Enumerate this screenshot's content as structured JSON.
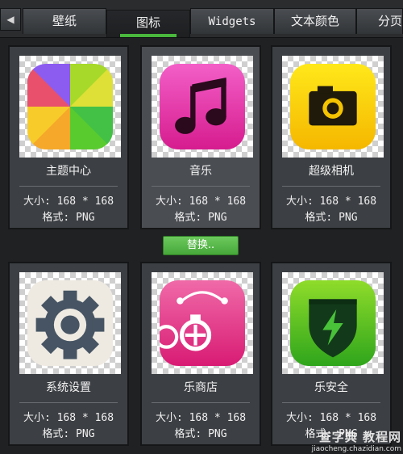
{
  "tabs": {
    "prev_arrow": "◀",
    "items": [
      {
        "label": "壁纸"
      },
      {
        "label": "图标"
      },
      {
        "label": "Widgets"
      },
      {
        "label": "文本颜色"
      },
      {
        "label": "分页"
      }
    ],
    "active_index": 1,
    "accent": "#49b83d"
  },
  "icons": [
    {
      "name": "主题中心",
      "size": "大小: 168 * 168",
      "format": "格式: PNG",
      "icon": "theme-center-icon"
    },
    {
      "name": "音乐",
      "size": "大小: 168 * 168",
      "format": "格式: PNG",
      "icon": "music-icon"
    },
    {
      "name": "超级相机",
      "size": "大小: 168 * 168",
      "format": "格式: PNG",
      "icon": "camera-icon"
    },
    {
      "name": "系统设置",
      "size": "大小: 168 * 168",
      "format": "格式: PNG",
      "icon": "settings-icon"
    },
    {
      "name": "乐商店",
      "size": "大小: 168 * 168",
      "format": "格式: PNG",
      "icon": "store-icon"
    },
    {
      "name": "乐安全",
      "size": "大小: 168 * 168",
      "format": "格式: PNG",
      "icon": "security-icon"
    }
  ],
  "replace_button": "替换..",
  "watermark": {
    "line1": "查字典 教程网",
    "line2": "jiaocheng.chazidian.com"
  }
}
